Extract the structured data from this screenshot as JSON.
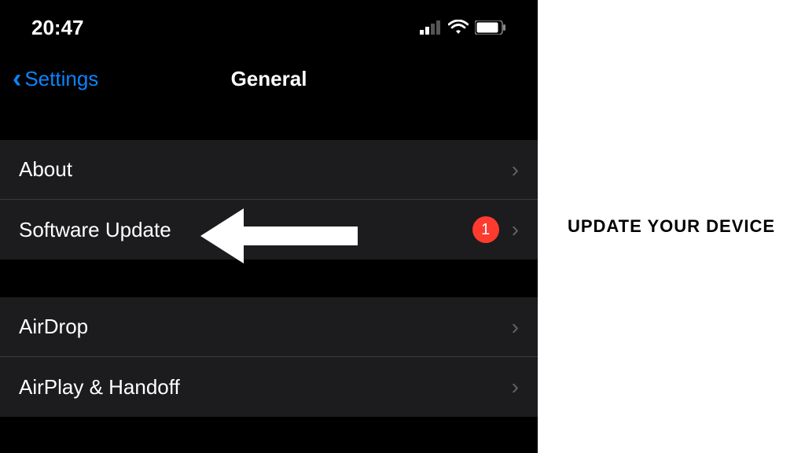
{
  "status": {
    "time": "20:47"
  },
  "nav": {
    "back_label": "Settings",
    "title": "General"
  },
  "section1": {
    "items": [
      {
        "label": "About"
      },
      {
        "label": "Software Update",
        "badge": "1"
      }
    ]
  },
  "section2": {
    "items": [
      {
        "label": "AirDrop"
      },
      {
        "label": "AirPlay & Handoff"
      }
    ]
  },
  "annotation": {
    "text": "UPDATE YOUR DEVICE"
  }
}
